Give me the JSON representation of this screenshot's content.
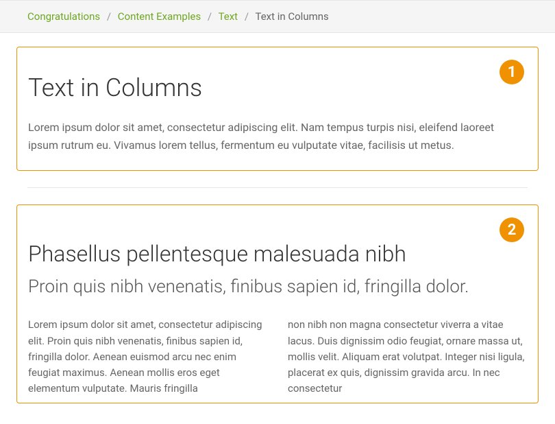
{
  "breadcrumb": {
    "items": [
      {
        "label": "Congratulations"
      },
      {
        "label": "Content Examples"
      },
      {
        "label": "Text"
      }
    ],
    "current": "Text in Columns",
    "separator": "/"
  },
  "block1": {
    "badge": "1",
    "title": "Text in Columns",
    "intro": "Lorem ipsum dolor sit amet, consectetur adipiscing elit. Nam tempus turpis nisi, eleifend laoreet ipsum rutrum eu. Vivamus lorem tellus, fermentum eu vulputate vitae, facilisis ut metus."
  },
  "block2": {
    "badge": "2",
    "heading": "Phasellus pellentesque malesuada nibh",
    "subheading": "Proin quis nibh venenatis, finibus sapien id, fringilla dolor.",
    "columns": {
      "left": "Lorem ipsum dolor sit amet, consectetur adipiscing elit. Proin quis nibh venenatis, finibus sapien id, fringilla dolor. Aenean euismod arcu nec enim feugiat maximus. Aenean mollis eros eget elementum vulputate. Mauris fringilla",
      "right": "non nibh non magna consectetur viverra a vitae lacus. Duis dignissim odio feugiat, ornare massa ut, mollis velit. Aliquam erat volutpat. Integer nisi ligula, placerat ex quis, dignissim gravida arcu. In nec consectetur"
    }
  }
}
